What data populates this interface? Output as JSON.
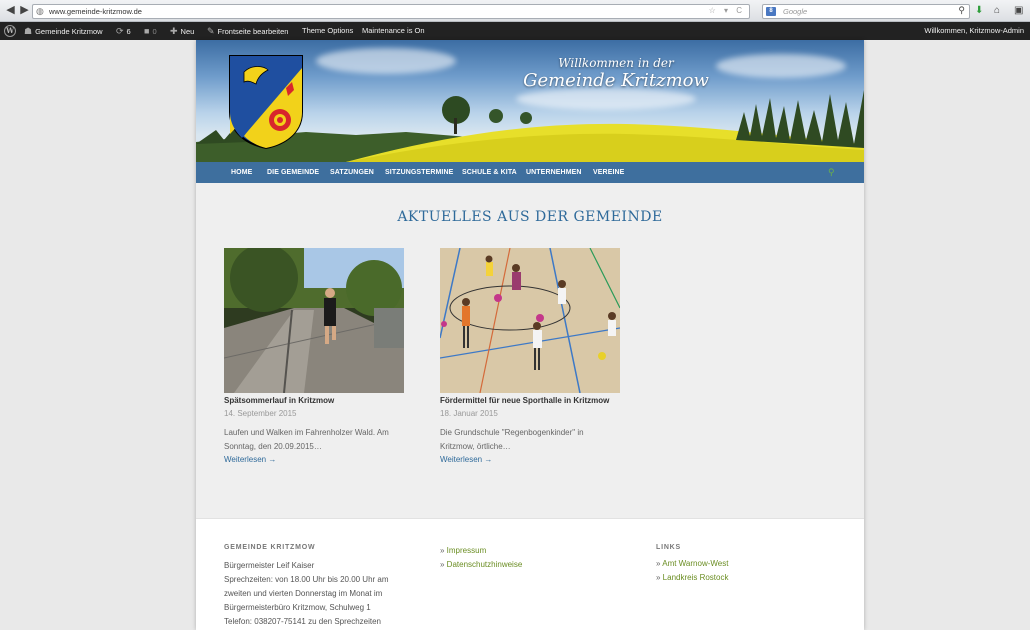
{
  "browser": {
    "url": "www.gemeinde-kritzmow.de",
    "search_placeholder": "Google",
    "search_engine_label": "8"
  },
  "adminbar": {
    "site_name": "Gemeinde Kritzmow",
    "updates_count": "6",
    "comments_count": "0",
    "new_label": "Neu",
    "edit_label": "Frontseite bearbeiten",
    "theme_options_label": "Theme Options",
    "maintenance_label": "Maintenance is On",
    "greeting": "Willkommen, Kritzmow-Admin"
  },
  "header": {
    "welcome_line1": "Willkommen in der",
    "welcome_line2": "Gemeinde Kritzmow"
  },
  "nav": {
    "items": [
      "HOME",
      "DIE GEMEINDE",
      "SATZUNGEN",
      "SITZUNGSTERMINE",
      "SCHULE & KITA",
      "UNTERNEHMEN",
      "VEREINE"
    ]
  },
  "section_title": "AKTUELLES AUS DER GEMEINDE",
  "posts": [
    {
      "title": "Spätsommerlauf in Kritzmow",
      "date": "14. September 2015",
      "excerpt_line1": "Laufen und Walken im Fahrenholzer Wald. Am",
      "excerpt_line2": "Sonntag, den 20.09.2015…",
      "more": "Weiterlesen →"
    },
    {
      "title": "Fördermittel für neue Sporthalle in Kritzmow",
      "date": "18. Januar 2015",
      "excerpt_line1": "Die Grundschule \"Regenbogenkinder\" in",
      "excerpt_line2": "Kritzmow, örtliche…",
      "more": "Weiterlesen →"
    }
  ],
  "footer": {
    "col1_heading": "GEMEINDE KRITZMOW",
    "col1_lines": [
      "Bürgermeister Leif Kaiser",
      "Sprechzeiten: von 18.00 Uhr bis 20.00 Uhr am",
      "zweiten und vierten Donnerstag im Monat im",
      "Bürgermeisterbüro Kritzmow, Schulweg 1",
      "Telefon: 038207-75141 zu den Sprechzeiten"
    ],
    "col2_links": [
      "Impressum",
      "Datenschutzhinweise"
    ],
    "col3_heading": "LINKS",
    "col3_links": [
      "Amt Warnow-West",
      "Landkreis Rostock"
    ]
  },
  "colors": {
    "nav_bg": "#3e6f9e",
    "title_blue": "#2f6a9a",
    "link_green": "#6b8e23",
    "crest_yellow": "#f2d21a",
    "crest_blue": "#1f4fa0",
    "crest_red": "#d8262c"
  }
}
